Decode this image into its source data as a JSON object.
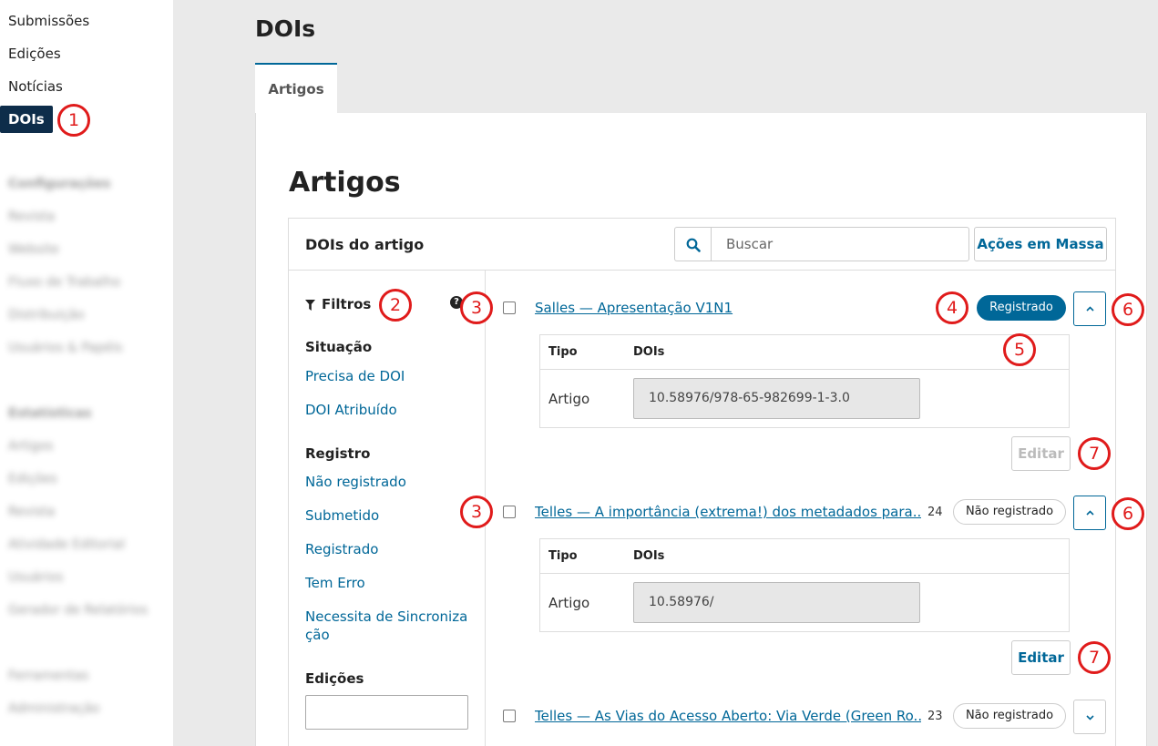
{
  "sidebar": {
    "items": [
      {
        "label": "Submissões"
      },
      {
        "label": "Edições"
      },
      {
        "label": "Notícias"
      },
      {
        "label": "DOIs",
        "active": true
      }
    ],
    "blurred_group1": [
      "Configurações",
      "Revista",
      "Website",
      "Fluxo de Trabalho",
      "Distribuição",
      "Usuários & Papéis"
    ],
    "blurred_group2": [
      "Estatísticas",
      "Artigos",
      "Edições",
      "Revista",
      "Atividade Editorial",
      "Usuários",
      "Gerador de Relatórios"
    ],
    "blurred_group3": [
      "Ferramentas",
      "Administração"
    ]
  },
  "page": {
    "title": "DOIs",
    "tab_label": "Artigos",
    "section_title": "Artigos"
  },
  "list": {
    "title": "DOIs do artigo",
    "search_placeholder": "Buscar",
    "bulk_actions_label": "Ações em Massa"
  },
  "filters": {
    "title": "Filtros",
    "help_icon": "?",
    "situacao_heading": "Situação",
    "situacao_options": [
      "Precisa de DOI",
      "DOI Atribuído"
    ],
    "registro_heading": "Registro",
    "registro_options": [
      "Não registrado",
      "Submetido",
      "Registrado",
      "Tem Erro",
      "Necessita de Sincroniza ção"
    ],
    "edicoes_heading": "Edições"
  },
  "items": [
    {
      "title": "Salles — Apresentação V1N1",
      "count": "",
      "status": "Registrado",
      "expanded": true,
      "table": {
        "col_type": "Tipo",
        "col_dois": "DOIs",
        "row_type": "Artigo",
        "doi_value": "10.58976/978-65-982699-1-3.0"
      },
      "edit_label": "Editar",
      "edit_enabled": false
    },
    {
      "title": "Telles — A importância (extrema!) dos metadados para...",
      "count": "24",
      "status": "Não registrado",
      "expanded": true,
      "table": {
        "col_type": "Tipo",
        "col_dois": "DOIs",
        "row_type": "Artigo",
        "doi_value": "10.58976/"
      },
      "edit_label": "Editar",
      "edit_enabled": true
    },
    {
      "title": "Telles — As Vias do Acesso Aberto: Via Verde (Green Ro...",
      "count": "23",
      "status": "Não registrado",
      "expanded": false
    }
  ],
  "callouts": [
    "1",
    "2",
    "3",
    "3",
    "4",
    "5",
    "6",
    "6",
    "7",
    "7"
  ],
  "colors": {
    "accent": "#006798",
    "sidebar_active": "#0e2d4a",
    "callout": "#e01b1b",
    "background": "#eaeaea"
  },
  "icons": {
    "search": "search-icon",
    "filter": "filter-icon",
    "help": "help-icon",
    "chevron_up": "chevron-up-icon",
    "chevron_down": "chevron-down-icon"
  }
}
